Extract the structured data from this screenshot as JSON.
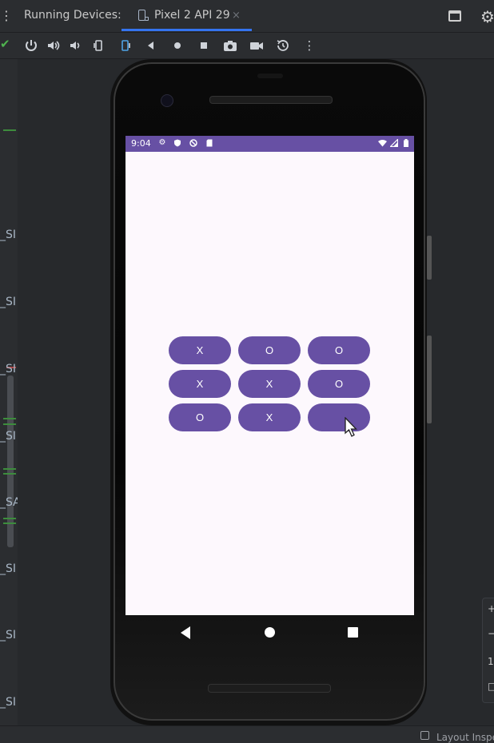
{
  "ide": {
    "running_label": "Running Devices:",
    "tab_label": "Pixel 2 API 29",
    "tab_close": "×",
    "layout_inspector": "Layout Inspe",
    "gutter_labels": [
      "_SI",
      "_SI",
      "_SI",
      "_SI",
      "_SA",
      "_SI",
      "_SI",
      "_SI"
    ],
    "side_panel": [
      "+",
      "−",
      "1",
      "□"
    ]
  },
  "toolbar": {
    "tools": [
      "power-icon",
      "volume-up-icon",
      "volume-down-icon",
      "rotate-left-icon",
      "rotate-right-icon",
      "back-icon",
      "home-icon",
      "overview-icon",
      "camera-icon",
      "record-icon",
      "history-icon",
      "more-icon"
    ]
  },
  "device": {
    "time": "9:04",
    "status_icons_left": [
      "settings-icon",
      "shield-icon",
      "no-disturb-icon",
      "sd-card-icon"
    ],
    "status_icons_right": [
      "wifi-icon",
      "signal-icon",
      "battery-icon"
    ],
    "accent": "#6750a4"
  },
  "board": {
    "cells": [
      "X",
      "O",
      "O",
      "X",
      "X",
      "O",
      "O",
      "X",
      ""
    ]
  }
}
